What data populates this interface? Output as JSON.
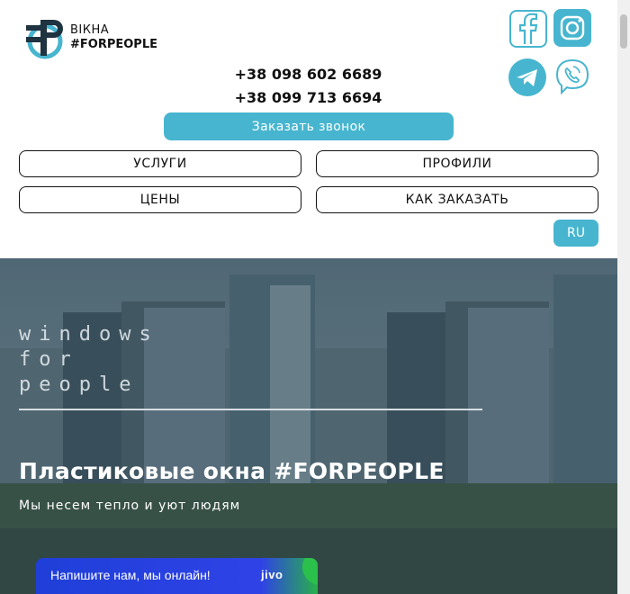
{
  "brand": {
    "line1": "ВІКНА",
    "line2": "#FORPEOPLE",
    "color_primary": "#47b5cf",
    "color_dark": "#1f3340"
  },
  "social": {
    "facebook": "facebook-icon",
    "instagram": "instagram-icon",
    "telegram": "telegram-icon",
    "viber": "viber-icon"
  },
  "contacts": {
    "phone1": "+38 098 602 6689",
    "phone2": "+38 099 713 6694",
    "callback_label": "Заказать звонок"
  },
  "nav": {
    "services": "УСЛУГИ",
    "profiles": "ПРОФИЛИ",
    "prices": "ЦЕНЫ",
    "how_to_order": "КАК ЗАКАЗАТЬ"
  },
  "language": "RU",
  "hero": {
    "tag1": "windows",
    "tag2": "for",
    "tag3": "people",
    "title": "Пластиковые окна #FORPEOPLE",
    "subtitle": "Мы несем тепло и уют людям"
  },
  "chat": {
    "text": "Напишите нам, мы онлайн!",
    "logo": "jivo"
  }
}
